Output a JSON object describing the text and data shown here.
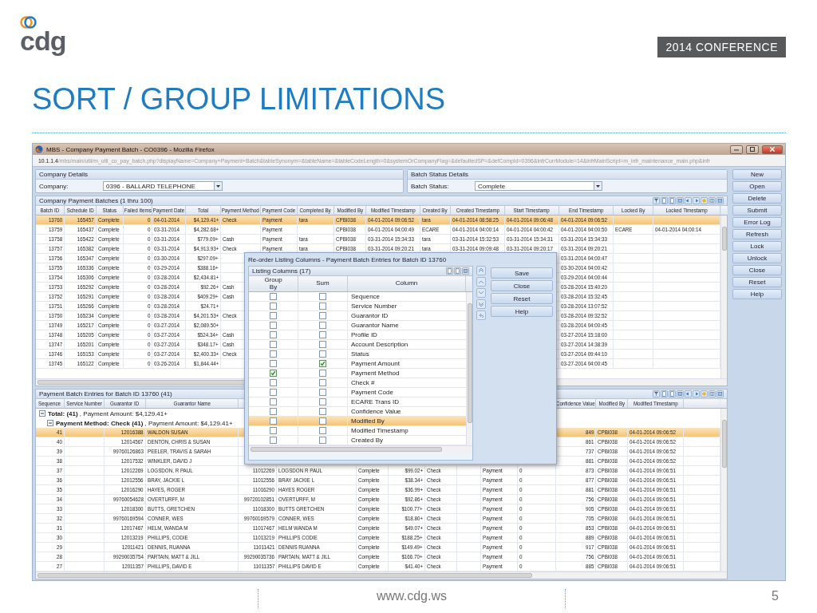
{
  "slide": {
    "logo_text": "cdg",
    "badge": "2014 CONFERENCE",
    "title": "SORT / GROUP LIMITATIONS",
    "footer_url": "www.cdg.ws",
    "page_number": "5"
  },
  "browser": {
    "title": "MBS - Company Payment Batch - CO0396 - Mozilla Firefox",
    "url_host": "10.1.1.4",
    "url_path": "/mbs/main/util/m_util_co_pay_batch.php?displayName=Company+Payment+Batch&tableSynonym=&tableName=&tableCodeLength=0&systemOrCompanyFlag=&defaultedSP=&defCompId=0396&infrCurrModule=14&infrMainScript=m_infr_maintenance_main.php&infr"
  },
  "company_details": {
    "title": "Company Details",
    "label": "Company:",
    "value": "0396 - BALLARD TELEPHONE"
  },
  "batch_status": {
    "title": "Batch Status Details",
    "label": "Batch Status:",
    "value": "Complete"
  },
  "batches": {
    "caption": "Company Payment Batches (1 thru 100)",
    "columns": [
      "Batch ID",
      "Schedule ID",
      "Status",
      "Failed Items",
      "Payment Date",
      "Total",
      "Payment Method",
      "Payment Code",
      "Completed By",
      "Modified By",
      "Modified Timestamp",
      "Created By",
      "Created Timestamp",
      "Start Timestamp",
      "End Timestamp",
      "Locked By",
      "Locked Timestamp"
    ],
    "rows": [
      {
        "selected": true,
        "cells": [
          "13760",
          "165457",
          "Complete",
          "0",
          "04-01-2014",
          "$4,129.41+",
          "Check",
          "Payment",
          "tara",
          "CPBI038",
          "04-01-2014 09:06:52",
          "tara",
          "04-01-2014 08:58:25",
          "04-01-2014 09:06:48",
          "04-01-2014 09:06:52",
          null,
          null
        ]
      },
      {
        "selected": false,
        "cells": [
          "13759",
          "165437",
          "Complete",
          "0",
          "03-31-2014",
          "$4,282.68+",
          null,
          "Payment",
          null,
          "CPBI038",
          "04-01-2014 04:00:49",
          "ECARE",
          "04-01-2014 04:00:14",
          "04-01-2014 04:00:42",
          "04-01-2014 04:00:50",
          "ECARE",
          "04-01-2014 04:00:14"
        ]
      },
      {
        "selected": false,
        "cells": [
          "13758",
          "165422",
          "Complete",
          "0",
          "03-31-2014",
          "$779.09+",
          "Cash",
          "Payment",
          "tara",
          "CPBI038",
          "03-31-2014 15:34:33",
          "tara",
          "03-31-2014 15:32:53",
          "03-31-2014 15:34:31",
          "03-31-2014 15:34:33",
          null,
          null
        ]
      },
      {
        "selected": false,
        "cells": [
          "13757",
          "165382",
          "Complete",
          "0",
          "03-31-2014",
          "$4,913.93+",
          "Check",
          "Payment",
          "tara",
          "CPBI038",
          "03-31-2014 09:20:21",
          "tara",
          "03-31-2014 09:09:48",
          "03-31-2014 09:20:17",
          "03-31-2014 09:20:21",
          null,
          null
        ]
      },
      {
        "selected": false,
        "cells": [
          "13756",
          "165347",
          "Complete",
          "0",
          "03-30-2014",
          "$297.09+",
          null,
          null,
          null,
          null,
          null,
          null,
          null,
          null,
          "03-31-2014 04:00:47",
          null,
          null
        ]
      },
      {
        "selected": false,
        "cells": [
          "13755",
          "165336",
          "Complete",
          "0",
          "03-29-2014",
          "$388.16+",
          null,
          null,
          null,
          null,
          null,
          null,
          null,
          null,
          "03-30-2014 04:00:42",
          null,
          null
        ]
      },
      {
        "selected": false,
        "cells": [
          "13754",
          "165306",
          "Complete",
          "0",
          "03-28-2014",
          "$2,434.81+",
          null,
          null,
          null,
          null,
          null,
          null,
          null,
          null,
          "03-29-2014 04:00:44",
          null,
          null
        ]
      },
      {
        "selected": false,
        "cells": [
          "13753",
          "165292",
          "Complete",
          "0",
          "03-28-2014",
          "$92.26+",
          "Cash",
          null,
          null,
          null,
          null,
          null,
          null,
          null,
          "03-28-2014 15:40:20",
          null,
          null
        ]
      },
      {
        "selected": false,
        "cells": [
          "13752",
          "165291",
          "Complete",
          "0",
          "03-28-2014",
          "$409.29+",
          "Cash",
          null,
          null,
          null,
          null,
          null,
          null,
          null,
          "03-28-2014 15:32:45",
          null,
          null
        ]
      },
      {
        "selected": false,
        "cells": [
          "13751",
          "165266",
          "Complete",
          "0",
          "03-28-2014",
          "$24.71+",
          null,
          null,
          null,
          null,
          null,
          null,
          null,
          null,
          "03-28-2014 13:07:52",
          null,
          null
        ]
      },
      {
        "selected": false,
        "cells": [
          "13750",
          "165234",
          "Complete",
          "0",
          "03-28-2014",
          "$4,201.53+",
          "Check",
          null,
          null,
          null,
          null,
          null,
          null,
          null,
          "03-28-2014 09:32:52",
          null,
          null
        ]
      },
      {
        "selected": false,
        "cells": [
          "13749",
          "165217",
          "Complete",
          "0",
          "03-27-2014",
          "$2,089.50+",
          null,
          null,
          null,
          null,
          null,
          null,
          null,
          null,
          "03-28-2014 04:00:45",
          null,
          null
        ]
      },
      {
        "selected": false,
        "cells": [
          "13748",
          "165205",
          "Complete",
          "0",
          "03-27-2014",
          "$524.34+",
          "Cash",
          null,
          null,
          null,
          null,
          null,
          null,
          null,
          "03-27-2014 15:18:00",
          null,
          null
        ]
      },
      {
        "selected": false,
        "cells": [
          "13747",
          "165201",
          "Complete",
          "0",
          "03-27-2014",
          "$348.17+",
          "Cash",
          null,
          null,
          null,
          null,
          null,
          null,
          null,
          "03-27-2014 14:38:39",
          null,
          null
        ]
      },
      {
        "selected": false,
        "cells": [
          "13746",
          "165153",
          "Complete",
          "0",
          "03-27-2014",
          "$2,400.33+",
          "Check",
          null,
          null,
          null,
          null,
          null,
          null,
          null,
          "03-27-2014 09:44:10",
          null,
          null
        ]
      },
      {
        "selected": false,
        "cells": [
          "13745",
          "165122",
          "Complete",
          "0",
          "03-26-2014",
          "$1,844.44+",
          null,
          null,
          null,
          null,
          null,
          null,
          null,
          null,
          "03-27-2014 04:00:45",
          null,
          null
        ]
      }
    ]
  },
  "entries": {
    "caption": "Payment Batch Entries for Batch ID 13760 (41)",
    "columns": [
      "Sequence",
      "Service Number",
      "Guarantor ID",
      "Guarantor Name",
      null,
      null,
      null,
      null,
      null,
      null,
      null,
      null,
      "Confidence Value",
      "Modified By",
      "Modified Timestamp"
    ],
    "groups": [
      {
        "text": "**Total: (41)** , Payment Amount: $4,129.41+",
        "expanded": true,
        "children": [
          {
            "text": "**Payment Method: Check (41)** , Payment Amount: $4,129.41+",
            "expanded": true
          }
        ]
      }
    ],
    "rows": [
      {
        "selected": true,
        "cells": [
          "41",
          null,
          "12016388",
          "WALDON SUSAN",
          null,
          null,
          null,
          null,
          null,
          null,
          null,
          null,
          "849",
          "CPBI038",
          "04-01-2014 09:06:52"
        ]
      },
      {
        "selected": false,
        "cells": [
          "40",
          null,
          "12014567",
          "DENTON, CHRIS & SUSAN",
          null,
          null,
          null,
          null,
          null,
          null,
          null,
          null,
          "861",
          "CPBI038",
          "04-01-2014 09:06:52"
        ]
      },
      {
        "selected": false,
        "cells": [
          "39",
          null,
          "99760126863",
          "PEELER, TRAVIS & SARAH",
          null,
          null,
          null,
          null,
          null,
          null,
          null,
          null,
          "737",
          "CPBI038",
          "04-01-2014 09:06:52"
        ]
      },
      {
        "selected": false,
        "cells": [
          "38",
          null,
          "12017532",
          "WINKLER, DAVID J",
          null,
          null,
          null,
          null,
          null,
          null,
          null,
          null,
          "881",
          "CPBI038",
          "04-01-2014 09:06:52"
        ]
      },
      {
        "selected": false,
        "cells": [
          "37",
          null,
          "12012269",
          "LOGSDON, R PAUL",
          "11012269",
          "LOGSDON R PAUL",
          "Complete",
          "$99.02+",
          "Check",
          null,
          "Payment",
          "0",
          "873",
          "CPBI038",
          "04-01-2014 09:06:51"
        ]
      },
      {
        "selected": false,
        "cells": [
          "36",
          null,
          "12012556",
          "BRAY, JACKIE L",
          "11012556",
          "BRAY JACKIE L",
          "Complete",
          "$38.34+",
          "Check",
          null,
          "Payment",
          "0",
          "877",
          "CPBI038",
          "04-01-2014 09:06:51"
        ]
      },
      {
        "selected": false,
        "cells": [
          "35",
          null,
          "12016290",
          "HAYES, ROGER",
          "11016290",
          "HAYES ROGER",
          "Complete",
          "$36.99+",
          "Check",
          null,
          "Payment",
          "0",
          "881",
          "CPBI038",
          "04-01-2014 09:06:51"
        ]
      },
      {
        "selected": false,
        "cells": [
          "34",
          null,
          "99760054628",
          "OVERTURFF, M",
          "99720102851",
          "OVERTURFF, M",
          "Complete",
          "$92.86+",
          "Check",
          null,
          "Payment",
          "0",
          "756",
          "CPBI038",
          "04-01-2014 09:06:51"
        ]
      },
      {
        "selected": false,
        "cells": [
          "33",
          null,
          "12018300",
          "BUTTS, GRETCHEN",
          "11018300",
          "BUTTS GRETCHEN",
          "Complete",
          "$100.77+",
          "Check",
          null,
          "Payment",
          "0",
          "905",
          "CPBI038",
          "04-01-2014 09:06:51"
        ]
      },
      {
        "selected": false,
        "cells": [
          "32",
          null,
          "99760169594",
          "CONNER, WES",
          "99760169579",
          "CONNER, WES",
          "Complete",
          "$18.80+",
          "Check",
          null,
          "Payment",
          "0",
          "705",
          "CPBI038",
          "04-01-2014 09:06:51"
        ]
      },
      {
        "selected": false,
        "cells": [
          "31",
          null,
          "12017467",
          "HELM, WANDA M",
          "11017467",
          "HELM WANDA M",
          "Complete",
          "$49.07+",
          "Check",
          null,
          "Payment",
          "0",
          "853",
          "CPBI038",
          "04-01-2014 09:06:51"
        ]
      },
      {
        "selected": false,
        "cells": [
          "30",
          null,
          "12013219",
          "PHILLIPS, CODIE",
          "11013219",
          "PHILLIPS CODIE",
          "Complete",
          "$188.25+",
          "Check",
          null,
          "Payment",
          "0",
          "889",
          "CPBI038",
          "04-01-2014 09:06:51"
        ]
      },
      {
        "selected": false,
        "cells": [
          "29",
          null,
          "12011421",
          "DENNIS, RUANNA",
          "11011421",
          "DENNIS RUANNA",
          "Complete",
          "$149.49+",
          "Check",
          null,
          "Payment",
          "0",
          "917",
          "CPBI038",
          "04-01-2014 09:06:51"
        ]
      },
      {
        "selected": false,
        "cells": [
          "28",
          null,
          "99290035754",
          "PARTAIN, MATT & JILL",
          "99290035736",
          "PARTAIN, MATT & JILL",
          "Complete",
          "$166.70+",
          "Check",
          null,
          "Payment",
          "0",
          "756",
          "CPBI038",
          "04-01-2014 09:06:51"
        ]
      },
      {
        "selected": false,
        "cells": [
          "27",
          null,
          "12011357",
          "PHILLIPS, DAVID E",
          "11011357",
          "PHILLIPS DAVID E",
          "Complete",
          "$41.40+",
          "Check",
          null,
          "Payment",
          "0",
          "885",
          "CPBI038",
          "04-01-2014 09:06:51"
        ]
      }
    ]
  },
  "side_buttons": [
    "New",
    "Open",
    "Delete",
    "Submit",
    "Error Log",
    "Refresh",
    "Lock",
    "Unlock",
    "Close",
    "Reset",
    "Help"
  ],
  "modal": {
    "title": "Re-order Listing Columns - Payment Batch Entries for Batch ID 13760",
    "panel_title": "Listing Columns (17)",
    "columns": [
      "Group By",
      "Sum",
      "Column"
    ],
    "rows": [
      {
        "column": "Sequence",
        "group_by": false,
        "sum": false,
        "selected": false
      },
      {
        "column": "Service Number",
        "group_by": false,
        "sum": false,
        "selected": false
      },
      {
        "column": "Guarantor ID",
        "group_by": false,
        "sum": false,
        "selected": false
      },
      {
        "column": "Guarantor Name",
        "group_by": false,
        "sum": false,
        "selected": false
      },
      {
        "column": "Profile ID",
        "group_by": false,
        "sum": false,
        "selected": false
      },
      {
        "column": "Account Description",
        "group_by": false,
        "sum": false,
        "selected": false
      },
      {
        "column": "Status",
        "group_by": false,
        "sum": false,
        "selected": false
      },
      {
        "column": "Payment Amount",
        "group_by": false,
        "sum": true,
        "selected": false
      },
      {
        "column": "Payment Method",
        "group_by": true,
        "sum": false,
        "selected": false
      },
      {
        "column": "Check #",
        "group_by": false,
        "sum": false,
        "selected": false
      },
      {
        "column": "Payment Code",
        "group_by": false,
        "sum": false,
        "selected": false
      },
      {
        "column": "ECARE Trans ID",
        "group_by": false,
        "sum": false,
        "selected": false
      },
      {
        "column": "Confidence Value",
        "group_by": false,
        "sum": false,
        "selected": false
      },
      {
        "column": "Modified By",
        "group_by": false,
        "sum": false,
        "selected": true
      },
      {
        "column": "Modified Timestamp",
        "group_by": false,
        "sum": false,
        "selected": false
      },
      {
        "column": "Created By",
        "group_by": false,
        "sum": false,
        "selected": false
      }
    ],
    "buttons": [
      "Save",
      "Close",
      "Reset",
      "Help"
    ]
  }
}
